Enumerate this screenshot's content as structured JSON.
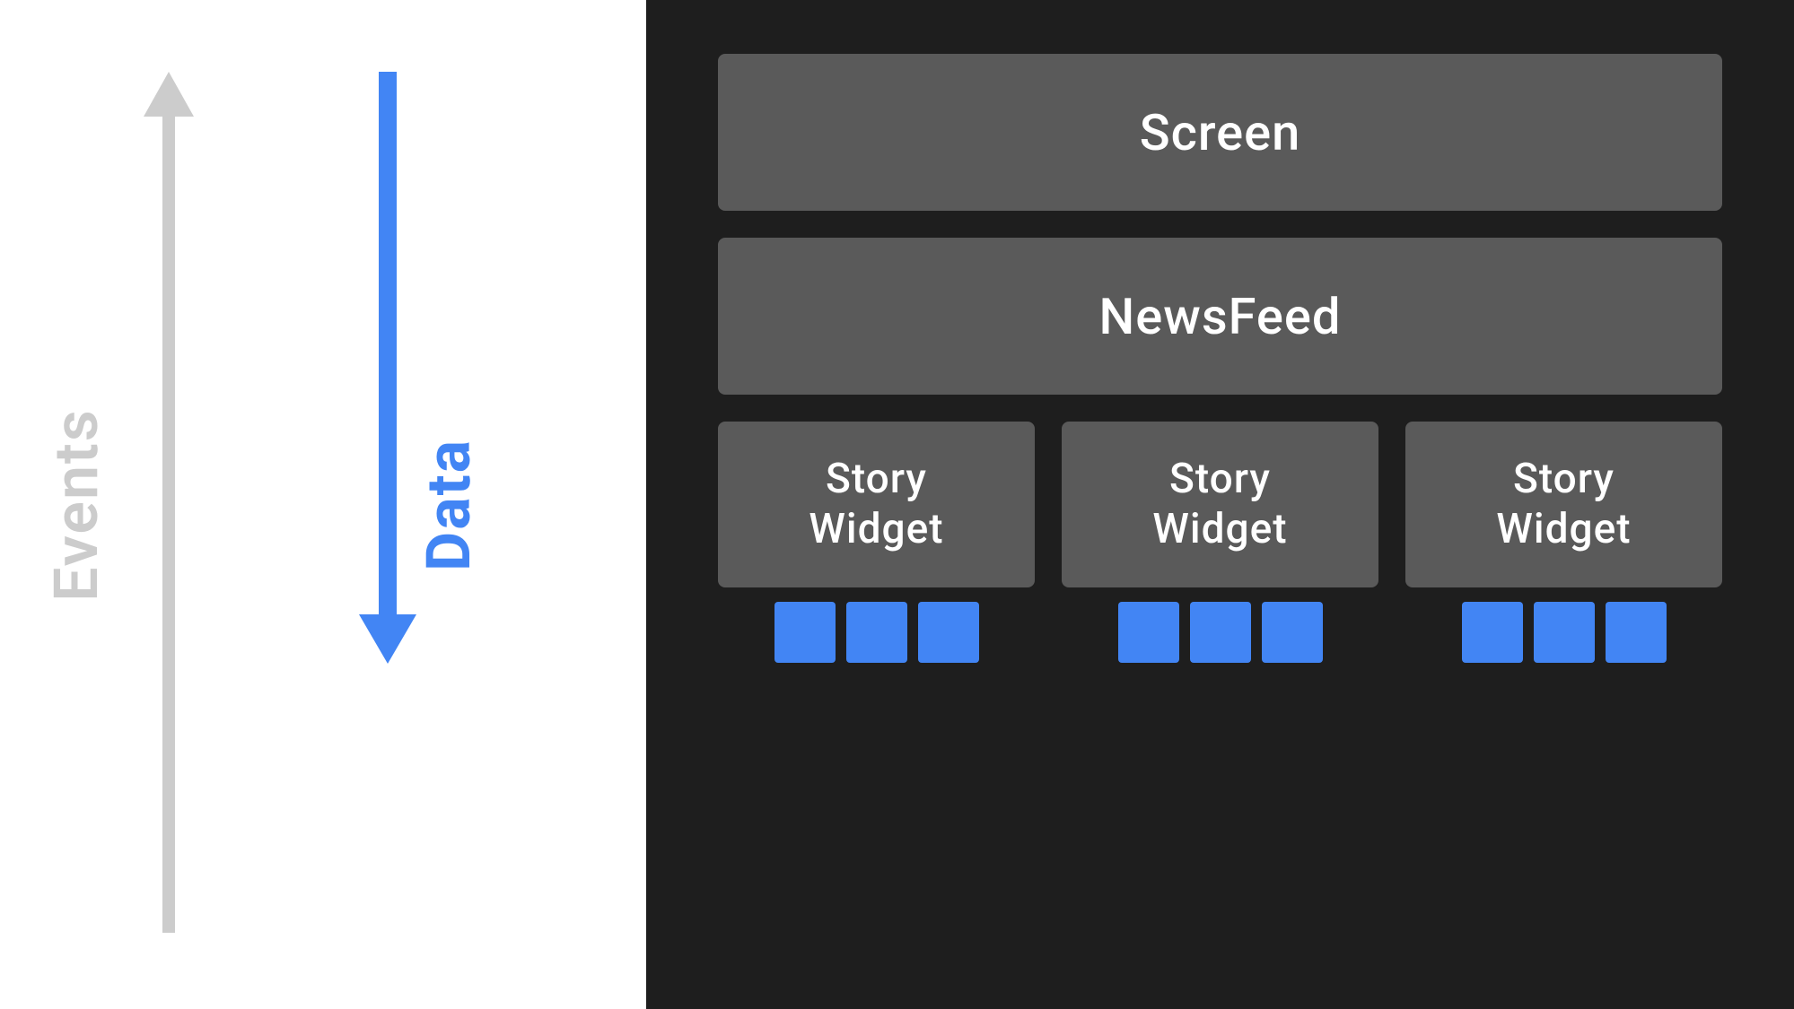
{
  "left": {
    "events_label": "Events",
    "data_label": "Data"
  },
  "right": {
    "screen_label": "Screen",
    "newsfeed_label": "NewsFeed",
    "story_widget_label": "Story\nWidget",
    "story_widgets": [
      {
        "label": "Story\nWidget"
      },
      {
        "label": "Story\nWidget"
      },
      {
        "label": "Story\nWidget"
      }
    ],
    "blue_squares_per_group": 3
  },
  "colors": {
    "blue": "#4285f4",
    "gray": "#cccccc",
    "dark_bg": "#1e1e1e",
    "block_bg": "#5a5a5a",
    "white": "#ffffff"
  }
}
